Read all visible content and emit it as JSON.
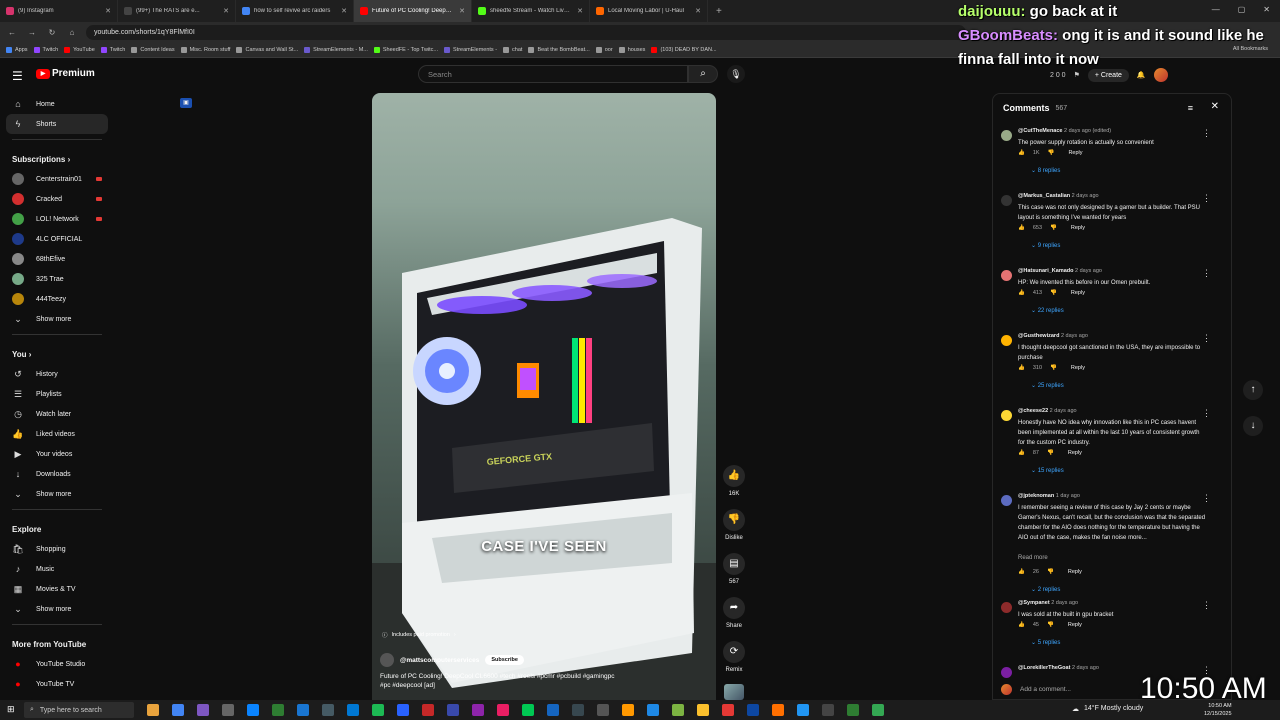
{
  "browser": {
    "tabs": [
      {
        "label": "(9) Instagram",
        "color": "#d6336c"
      },
      {
        "label": "(99+) The RATS are e...",
        "color": "#444"
      },
      {
        "label": "how to self revive arc raiders",
        "color": "#4285f4"
      },
      {
        "label": "Future of PC Cooling! DeepCoo...",
        "color": "#ff0000",
        "active": true
      },
      {
        "label": "sheedfe Stream - Watch Live c...",
        "color": "#53fc18"
      },
      {
        "label": "Local Moving Labor | U-Haul",
        "color": "#ff6600"
      }
    ],
    "new_tab": "+",
    "url": "youtube.com/shorts/1qY8FlMfI0I",
    "bookmarks": [
      "Apps",
      "Twitch",
      "YouTube",
      "Twitch",
      "Content Ideas",
      "Misc. Room stuff",
      "Canvas and Wall St...",
      "StreamElements - M...",
      "SheedFE - Top Twitc...",
      "StreamElements -",
      "chat",
      "Beat the BombBeat...",
      "oor",
      "houses",
      "(103) DEAD BY DAN..."
    ],
    "all_bookmarks": "All Bookmarks"
  },
  "yt": {
    "logo": "Premium",
    "search_placeholder": "Search",
    "create": "Create",
    "header_counts": "2  0  0"
  },
  "sidebar": {
    "main": [
      {
        "label": "Home",
        "icon": "⌂"
      },
      {
        "label": "Shorts",
        "icon": "ϟ"
      }
    ],
    "subs_title": "Subscriptions ›",
    "subs": [
      {
        "label": "Centerstrain01",
        "color": "#666",
        "live": true
      },
      {
        "label": "Cracked",
        "color": "#d32f2f",
        "live": true
      },
      {
        "label": "LOL! Network",
        "color": "#43a047",
        "live": true
      },
      {
        "label": "4LC OFFICIAL",
        "color": "#1e3a8a",
        "live": false
      },
      {
        "label": "68thEfive",
        "color": "#888",
        "live": false
      },
      {
        "label": "325 Trae",
        "color": "#7a8",
        "live": false
      },
      {
        "label": "444Teezy",
        "color": "#b8860b",
        "live": false
      }
    ],
    "subs_show_more": "Show more",
    "you_title": "You ›",
    "you": [
      {
        "label": "History",
        "icon": "↺"
      },
      {
        "label": "Playlists",
        "icon": "☰"
      },
      {
        "label": "Watch later",
        "icon": "◷"
      },
      {
        "label": "Liked videos",
        "icon": "👍"
      },
      {
        "label": "Your videos",
        "icon": "▶"
      },
      {
        "label": "Downloads",
        "icon": "↓"
      }
    ],
    "you_show_more": "Show more",
    "explore_title": "Explore",
    "explore": [
      {
        "label": "Shopping",
        "icon": "🛍"
      },
      {
        "label": "Music",
        "icon": "♪"
      },
      {
        "label": "Movies & TV",
        "icon": "▦"
      }
    ],
    "explore_show_more": "Show more",
    "more_title": "More from YouTube",
    "more": [
      {
        "label": "YouTube Studio"
      },
      {
        "label": "YouTube TV"
      },
      {
        "label": "YouTube Music"
      }
    ]
  },
  "video": {
    "caption": "CASE I'VE SEEN",
    "promo": "Includes paid promotion",
    "channel": "@mattscomputerservices",
    "subscribe": "Subscribe",
    "title": "Future of PC Cooling! DeepCool CL6600 #tech #reels #pcmr #pcbuild #gamingpc #pc #deepcool [ad]",
    "gpu_label": "GEFORCE GTX"
  },
  "actions": {
    "likes": "16K",
    "dislike": "Dislike",
    "comments": "567",
    "share": "Share",
    "remix": "Remix"
  },
  "chat": {
    "line1_user": "daijouuu:",
    "line1_text": " go back at it",
    "line2_user": "GBoomBeats:",
    "line2_text": " ong it is and it sound like he finna fall into it now"
  },
  "comments": {
    "title": "Comments",
    "count": "567",
    "add_placeholder": "Add a comment...",
    "items": [
      {
        "user": "@CutTheMenace",
        "time": "2 days ago (edited)",
        "text": "The power supply rotation is actually so convenient",
        "likes": "1K",
        "replies": "8 replies",
        "color": "#9a8"
      },
      {
        "user": "@Markus_Castalian",
        "time": "2 days ago",
        "text": "This case was not only designed by a gamer but a builder. That PSU layout is something I've wanted for years",
        "likes": "653",
        "replies": "9 replies",
        "color": "#333"
      },
      {
        "user": "@Hatsunari_Kamado",
        "time": "2 days ago",
        "text": "HP: We invented this before in our Omen prebuilt.",
        "likes": "413",
        "replies": "22 replies",
        "color": "#e57373"
      },
      {
        "user": "@Gusthewizard",
        "time": "2 days ago",
        "text": "I thought deepcool got sanctioned in the USA, they are impossible to purchase",
        "likes": "310",
        "replies": "25 replies",
        "color": "#ffb300"
      },
      {
        "user": "@cheese22",
        "time": "2 days ago",
        "text": "Honestly have NO idea why innovation like this in PC cases havent been implemented at all within the last 10 years of consistent growth for the custom PC industry.",
        "likes": "87",
        "replies": "15 replies",
        "color": "#fdd835"
      },
      {
        "user": "@jpteknoman",
        "time": "1 day ago",
        "text": "I remember seeing a review of this case by Jay 2 cents or maybe Gamer's Nexus, can't recall, but the conclusion was that the separated chamber for the AIO does nothing for the temperature but having the AIO out of the case, makes the fan noise more...",
        "likes": "26",
        "replies": "2 replies",
        "read_more": "Read more",
        "color": "#5c6bc0"
      },
      {
        "user": "@Sympanet",
        "time": "2 days ago",
        "text": "I was sold at the built in gpu bracket",
        "likes": "45",
        "replies": "5 replies",
        "color": "#8d2b2b"
      },
      {
        "user": "@LorekillerTheGoat",
        "time": "2 days ago",
        "text": "",
        "likes": "",
        "replies": "",
        "color": "#7b1fa2"
      }
    ],
    "reply_label": "Reply"
  },
  "taskbar": {
    "search": "Type here to search",
    "weather": "14°F  Mostly cloudy",
    "time_small": "10:50 AM",
    "date_small": "12/15/2025",
    "big_time": "10:50 AM"
  }
}
